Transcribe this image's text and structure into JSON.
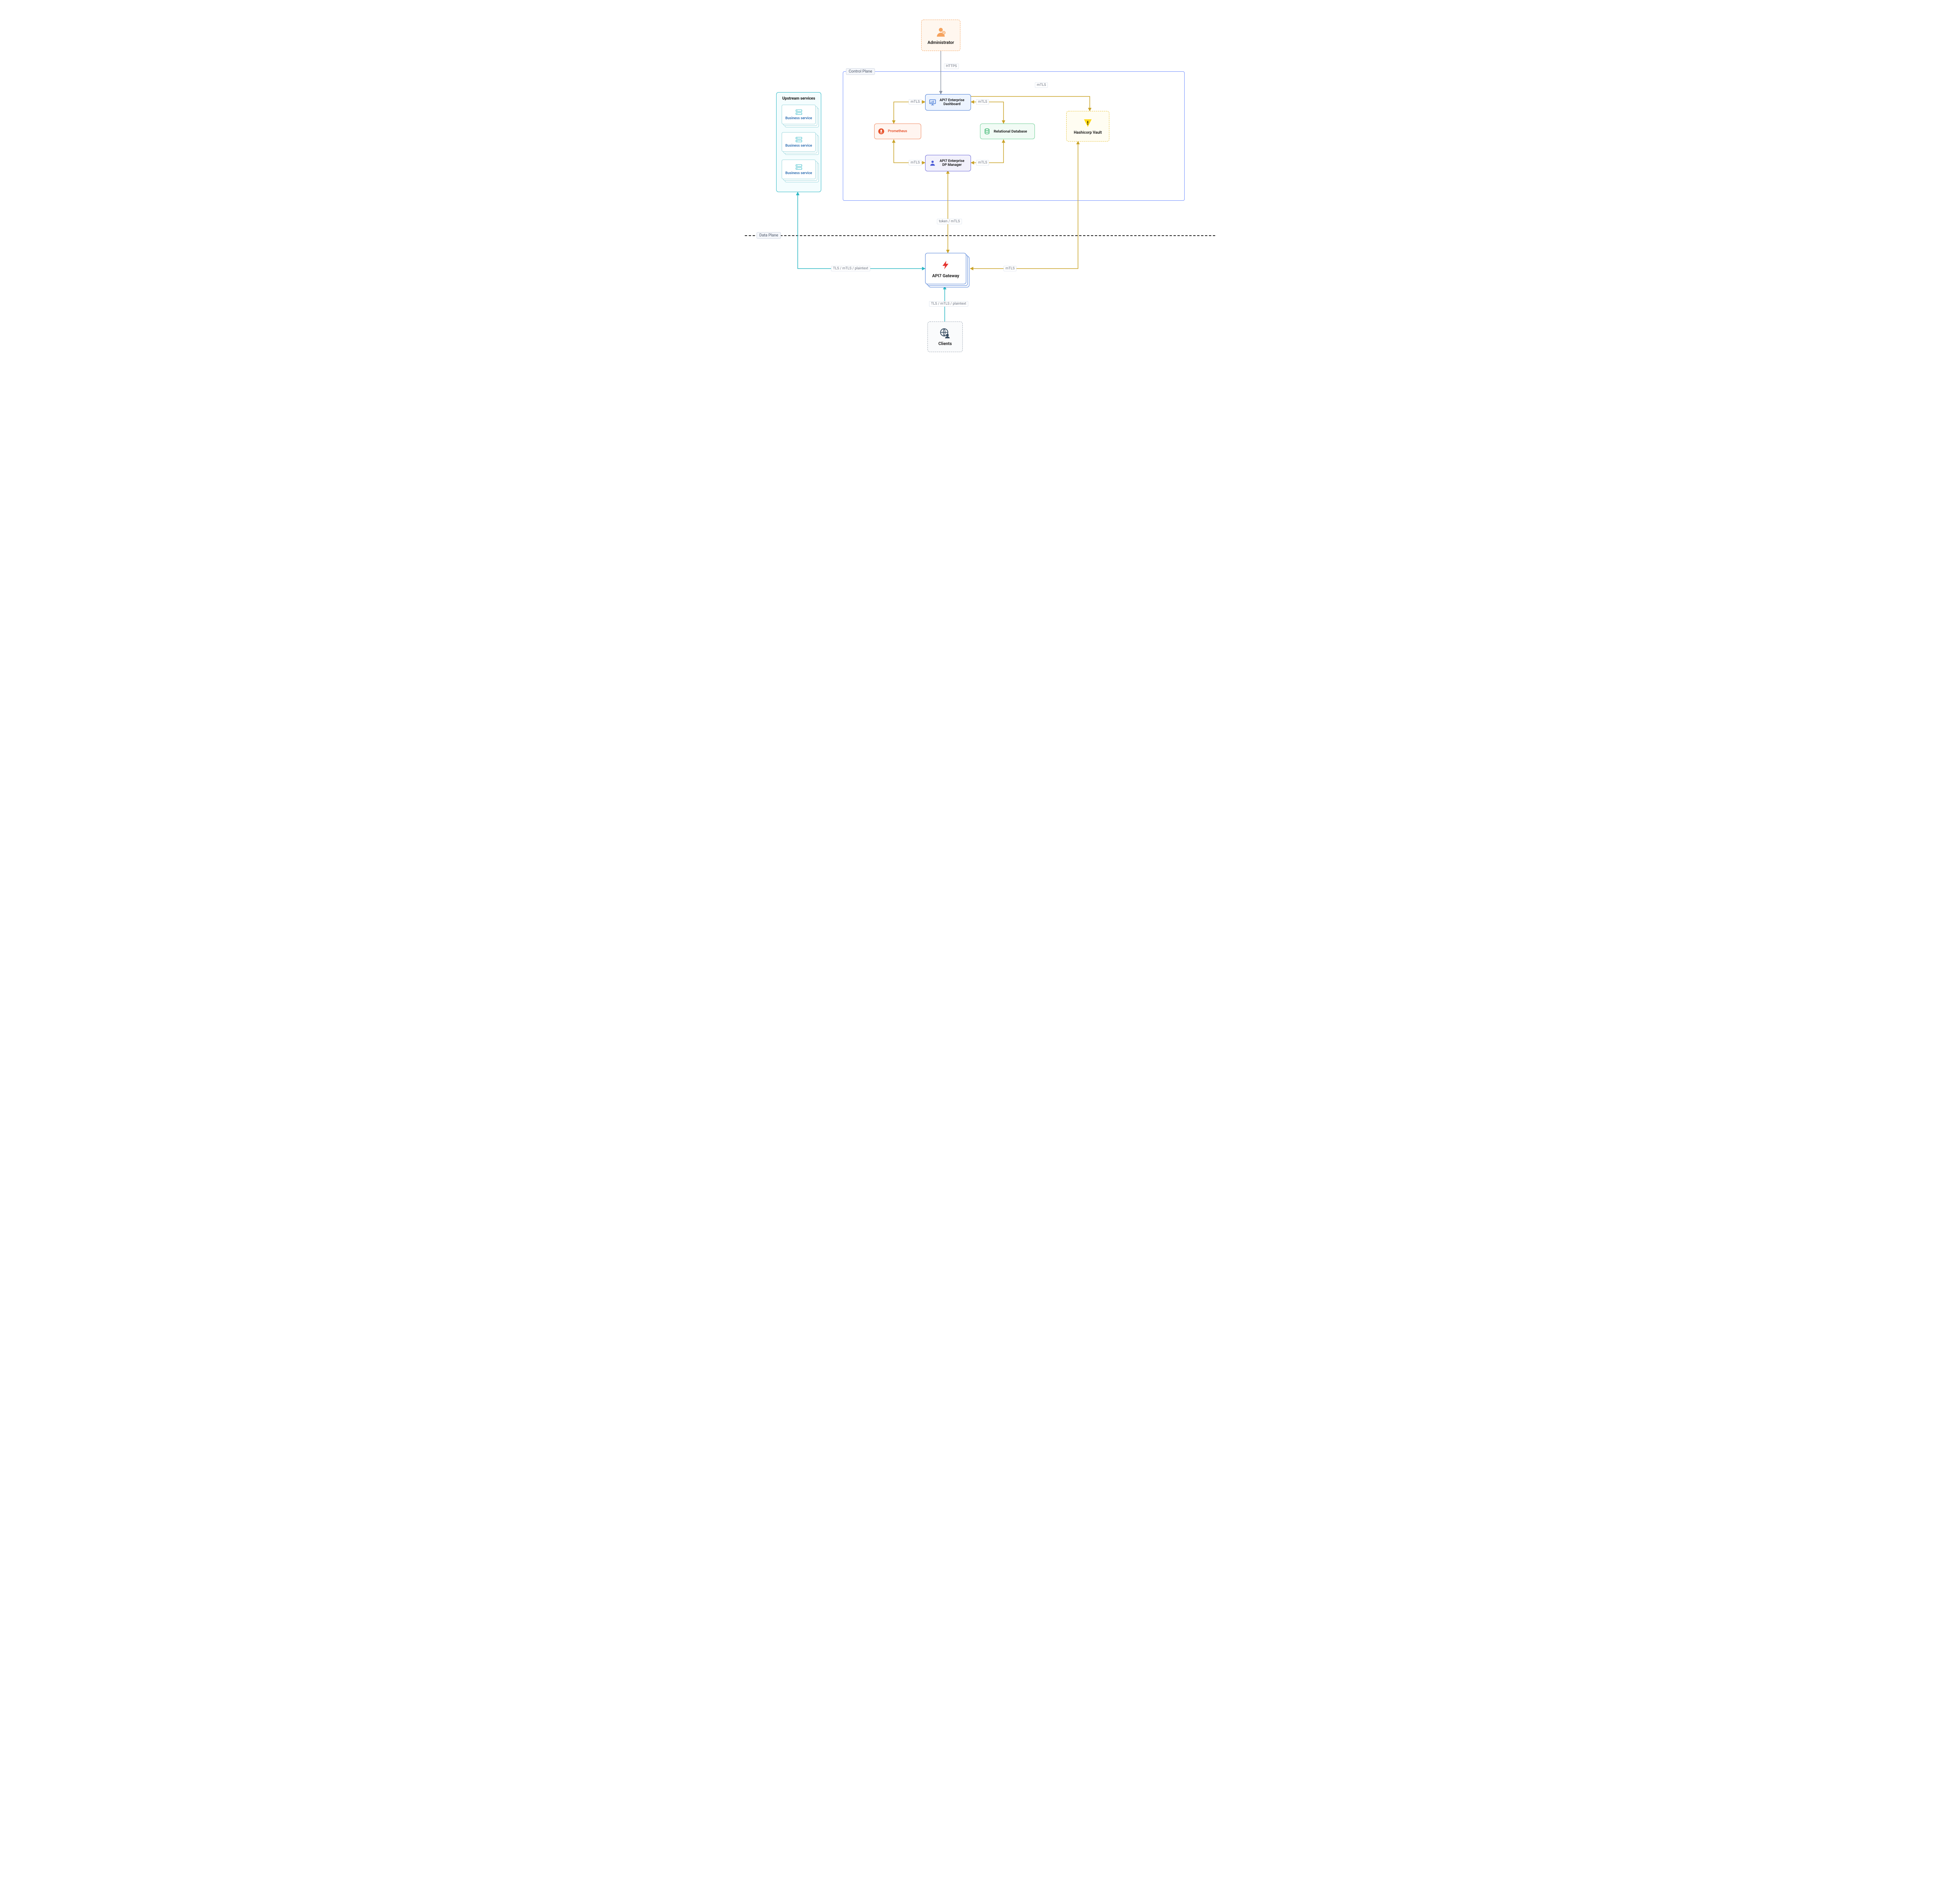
{
  "nodes": {
    "admin": {
      "label": "Administrator"
    },
    "dashboard": {
      "label": "API7 Enterprise\nDashboard"
    },
    "prometheus": {
      "label": "Prometheus"
    },
    "db": {
      "label": "Relational Database"
    },
    "dpmanager": {
      "label": "API7 Enterprise\nDP Manager"
    },
    "vault": {
      "label": "Hashicorp Vault"
    },
    "gateway": {
      "label": "API7 Gateway"
    },
    "clients": {
      "label": "Clients"
    },
    "upstream_title": "Upstream services",
    "business_service": "Business service"
  },
  "planes": {
    "control": "Control Plane",
    "data": "Data Plane"
  },
  "edges": {
    "https": "HTTPS",
    "mtls": "mTLS",
    "token_mtls": "token / mTLS",
    "tls_mtls_plain": "TLS / mTLS / plaintext"
  },
  "colors": {
    "admin_border": "#f5a25d",
    "admin_fill": "#fff7ef",
    "dashboard_border": "#4a7dd6",
    "dashboard_fill": "#edf4ff",
    "prom_border": "#f08b63",
    "prom_fill": "#fff5f0",
    "db_border": "#6fcf97",
    "db_fill": "#f1fbf5",
    "dp_border": "#6b68d8",
    "dp_fill": "#f2f1fc",
    "vault_border": "#e6c233",
    "vault_fill": "#fffdf2",
    "gw_border": "#4a7dd6",
    "gw_fill": "#ffffff",
    "clients_border": "#9aa5b1",
    "clients_fill": "#fafbfc",
    "upstream_border": "#2bb7c4",
    "upstream_fill": "#f4fdfe",
    "gold": "#c9a227",
    "gray": "#8a94a6",
    "teal": "#2bb7c4",
    "blue": "#6d8cff"
  }
}
